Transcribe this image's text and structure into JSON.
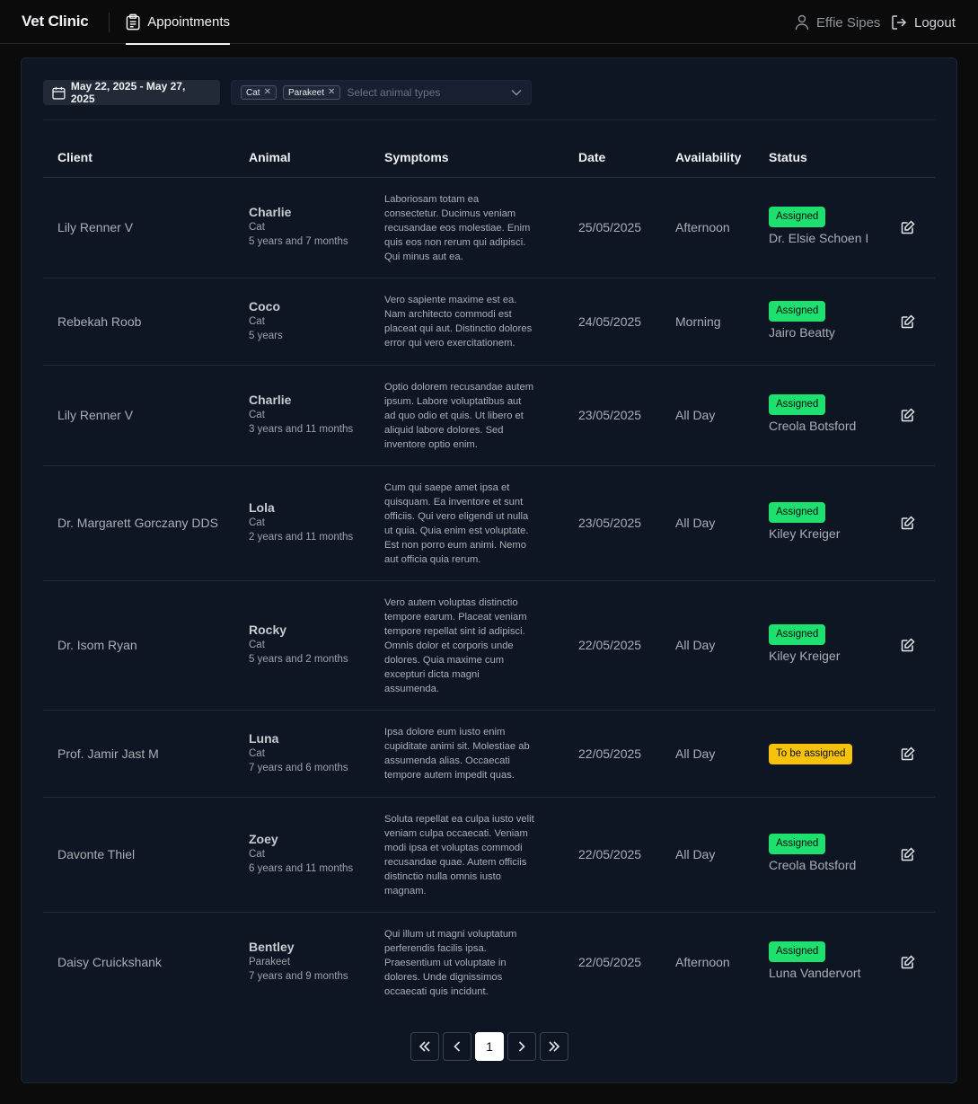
{
  "app": {
    "brand": "Vet Clinic"
  },
  "nav": {
    "tab_label": "Appointments",
    "user_name": "Effie Sipes",
    "logout_label": "Logout"
  },
  "filters": {
    "date_range": "May 22, 2025 - May 27, 2025",
    "animal_chips": [
      "Cat",
      "Parakeet"
    ],
    "animal_placeholder": "Select animal types"
  },
  "table": {
    "headers": [
      "Client",
      "Animal",
      "Symptoms",
      "Date",
      "Availability",
      "Status"
    ],
    "rows": [
      {
        "client": "Lily Renner V",
        "animal_name": "Charlie",
        "animal_type": "Cat",
        "animal_age": "5 years and 7 months",
        "symptoms": [
          "Laboriosam totam ea",
          "consectetur. Ducimus veniam",
          "recusandae eos molestiae. Enim",
          "quis eos non rerum qui adipisci.",
          "Qui minus aut ea."
        ],
        "date": "25/05/2025",
        "availability": "Afternoon",
        "status": "Assigned",
        "vet": "Dr. Elsie Schoen I"
      },
      {
        "client": "Rebekah Roob",
        "animal_name": "Coco",
        "animal_type": "Cat",
        "animal_age": "5 years",
        "symptoms": [
          "Vero sapiente maxime est ea.",
          "Nam architecto commodi est",
          "placeat qui aut. Distinctio dolores",
          "error qui vero exercitationem."
        ],
        "date": "24/05/2025",
        "availability": "Morning",
        "status": "Assigned",
        "vet": "Jairo Beatty"
      },
      {
        "client": "Lily Renner V",
        "animal_name": "Charlie",
        "animal_type": "Cat",
        "animal_age": "3 years and 11 months",
        "symptoms": [
          "Optio dolorem recusandae autem",
          "ipsum. Labore voluptatibus aut",
          "ad quo odio et quis. Ut libero et",
          "aliquid labore dolores. Sed",
          "inventore optio enim."
        ],
        "date": "23/05/2025",
        "availability": "All Day",
        "status": "Assigned",
        "vet": "Creola Botsford"
      },
      {
        "client": "Dr. Margarett Gorczany DDS",
        "animal_name": "Lola",
        "animal_type": "Cat",
        "animal_age": "2 years and 11 months",
        "symptoms": [
          "Cum qui saepe amet ipsa et",
          "quisquam. Ea inventore et sunt",
          "officiis. Qui vero eligendi ut nulla",
          "ut quia. Quia enim est voluptate.",
          "Est non porro eum animi. Nemo",
          "aut officia quia rerum."
        ],
        "date": "23/05/2025",
        "availability": "All Day",
        "status": "Assigned",
        "vet": "Kiley Kreiger"
      },
      {
        "client": "Dr. Isom Ryan",
        "animal_name": "Rocky",
        "animal_type": "Cat",
        "animal_age": "5 years and 2 months",
        "symptoms": [
          "Vero autem voluptas distinctio",
          "tempore earum. Placeat veniam",
          "tempore repellat sint id adipisci.",
          "Omnis dolor et corporis unde",
          "dolores. Quia maxime cum",
          "excepturi dicta magni",
          "assumenda."
        ],
        "date": "22/05/2025",
        "availability": "All Day",
        "status": "Assigned",
        "vet": "Kiley Kreiger"
      },
      {
        "client": "Prof. Jamir Jast M",
        "animal_name": "Luna",
        "animal_type": "Cat",
        "animal_age": "7 years and 6 months",
        "symptoms": [
          "Ipsa dolore eum iusto enim",
          "cupiditate animi sit. Molestiae ab",
          "assumenda alias. Occaecati",
          "tempore autem impedit quas."
        ],
        "date": "22/05/2025",
        "availability": "All Day",
        "status": "To be assigned",
        "vet": ""
      },
      {
        "client": "Davonte Thiel",
        "animal_name": "Zoey",
        "animal_type": "Cat",
        "animal_age": "6 years and 11 months",
        "symptoms": [
          "Soluta repellat ea culpa iusto velit",
          "veniam culpa occaecati. Veniam",
          "modi ipsa et voluptas commodi",
          "recusandae quae. Autem officiis",
          "distinctio nulla omnis iusto",
          "magnam."
        ],
        "date": "22/05/2025",
        "availability": "All Day",
        "status": "Assigned",
        "vet": "Creola Botsford"
      },
      {
        "client": "Daisy Cruickshank",
        "animal_name": "Bentley",
        "animal_type": "Parakeet",
        "animal_age": "7 years and 9 months",
        "symptoms": [
          "Qui illum ut magni voluptatum",
          "perferendis facilis ipsa.",
          "Praesentium ut voluptate in",
          "dolores. Unde dignissimos",
          "occaecati quis incidunt."
        ],
        "date": "22/05/2025",
        "availability": "Afternoon",
        "status": "Assigned",
        "vet": "Luna Vandervort"
      }
    ]
  },
  "pagination": {
    "current_page": "1"
  },
  "colors": {
    "assigned_badge": "#1ee06f",
    "pending_badge": "#f6c20b",
    "card_bg": "#0f1623"
  },
  "icons": {
    "tab": "clipboard-icon",
    "user": "user-icon",
    "logout": "logout-icon",
    "date": "calendar-icon",
    "chip_remove": "close-icon",
    "dropdown": "chevron-down-icon",
    "row_action": "edit-icon",
    "pagination": [
      "chevrons-left-icon",
      "chevron-left-icon",
      "chevron-right-icon",
      "chevrons-right-icon"
    ]
  }
}
